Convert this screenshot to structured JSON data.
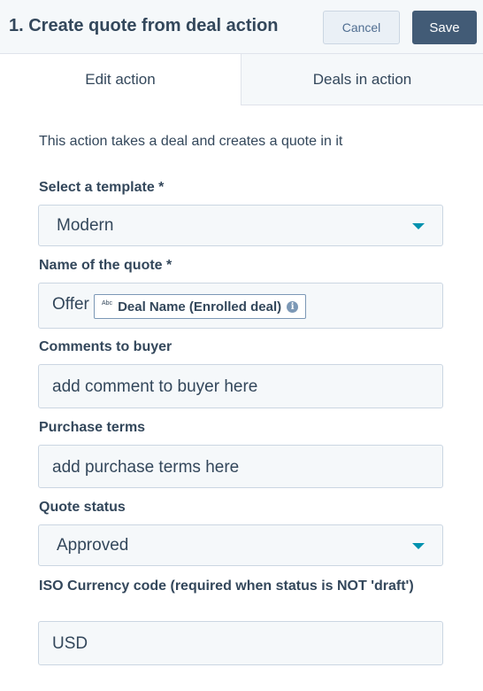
{
  "header": {
    "title": "1. Create quote from deal action",
    "cancel_label": "Cancel",
    "save_label": "Save"
  },
  "tabs": [
    {
      "label": "Edit action",
      "active": true
    },
    {
      "label": "Deals in action",
      "active": false
    }
  ],
  "description": "This action takes a deal and creates a quote in it",
  "form": {
    "template": {
      "label": "Select a template *",
      "value": "Modern"
    },
    "quote_name": {
      "label": "Name of the quote *",
      "prefix": "Offer",
      "token_type": "Abc",
      "token_label": "Deal Name (Enrolled deal)",
      "token_info_icon": "i"
    },
    "comments": {
      "label": "Comments to buyer",
      "value": "add comment to buyer here"
    },
    "purchase_terms": {
      "label": "Purchase terms",
      "value": "add purchase terms here"
    },
    "status": {
      "label": "Quote status",
      "value": "Approved"
    },
    "currency": {
      "label": "ISO Currency code (required when status is NOT 'draft')",
      "value": "USD"
    }
  },
  "icons": {
    "dropdown": "chevron-down-icon",
    "token_info": "info-icon"
  },
  "colors": {
    "primary_button": "#425b76",
    "accent_caret": "#0091ae",
    "field_background": "#f5f8fa"
  }
}
